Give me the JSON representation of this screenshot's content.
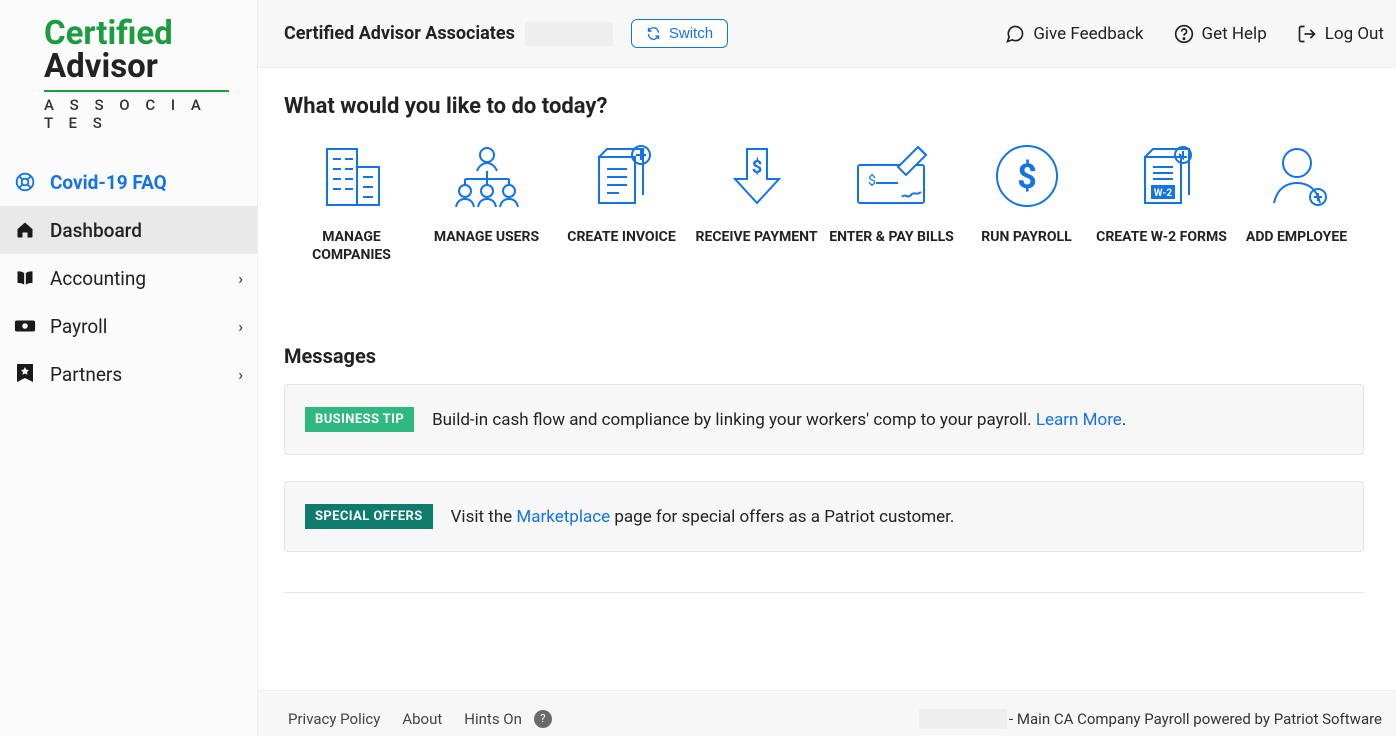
{
  "logo": {
    "line1": "Certified",
    "line2": "Advisor",
    "line3": "A S S O C I A T E S"
  },
  "nav": {
    "covid": "Covid-19 FAQ",
    "dashboard": "Dashboard",
    "accounting": "Accounting",
    "payroll": "Payroll",
    "partners": "Partners"
  },
  "topbar": {
    "company": "Certified Advisor Associates",
    "switch": "Switch",
    "feedback": "Give Feedback",
    "help": "Get Help",
    "logout": "Log Out"
  },
  "heading": "What would you like to do today?",
  "actions": {
    "manageCompanies": "MANAGE COMPANIES",
    "manageUsers": "MANAGE USERS",
    "createInvoice": "CREATE INVOICE",
    "receivePayment": "RECEIVE PAYMENT",
    "enterPayBills": "ENTER & PAY BILLS",
    "runPayroll": "RUN PAYROLL",
    "createW2": "CREATE W-2 FORMS",
    "addEmployee": "ADD EMPLOYEE"
  },
  "messagesTitle": "Messages",
  "messages": {
    "tip": {
      "badge": "BUSINESS TIP",
      "textA": "Build-in cash flow and compliance by linking your workers' comp to your payroll. ",
      "link": "Learn More",
      "textB": "."
    },
    "offer": {
      "badge": "SPECIAL OFFERS",
      "textA": "Visit the ",
      "link": "Marketplace",
      "textB": " page for special offers as a Patriot customer."
    }
  },
  "footer": {
    "privacy": "Privacy Policy",
    "about": "About",
    "hints": "Hints On",
    "rightText": " - Main CA Company Payroll powered by Patriot Software"
  }
}
